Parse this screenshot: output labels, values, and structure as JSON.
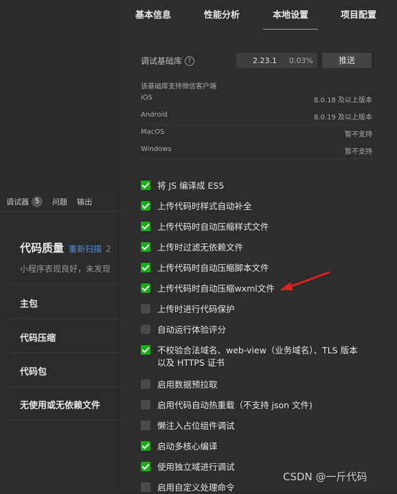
{
  "left": {
    "debug_tabs": {
      "debugger": "调试器",
      "debugger_count": "5",
      "problems": "问题",
      "output": "输出"
    },
    "quality_title": "代码质量",
    "rescan": "重新扫描",
    "quality_num": "2",
    "description": "小程序表现良好，未发现",
    "items": [
      "主包",
      "代码压缩",
      "代码包",
      "无使用或无依赖文件"
    ]
  },
  "tabs": [
    "基本信息",
    "性能分析",
    "本地设置",
    "项目配置"
  ],
  "active_tab": "本地设置",
  "lib": {
    "label": "调试基础库",
    "version": "2.23.1",
    "percent": "0.03%",
    "push": "推送"
  },
  "support_note": "该基础库支持微信客户端",
  "platforms": [
    {
      "name": "iOS",
      "req": "8.0.18 及以上版本"
    },
    {
      "name": "Android",
      "req": "8.0.19 及以上版本"
    },
    {
      "name": "MacOS",
      "req": "暂不支持"
    },
    {
      "name": "Windows",
      "req": "暂不支持"
    }
  ],
  "options": [
    {
      "label": "将 JS 编译成 ES5",
      "checked": true
    },
    {
      "label": "上传代码时样式自动补全",
      "checked": true
    },
    {
      "label": "上传代码时自动压缩样式文件",
      "checked": true
    },
    {
      "label": "上传时过滤无依赖文件",
      "checked": true
    },
    {
      "label": "上传代码时自动压缩脚本文件",
      "checked": true
    },
    {
      "label": "上传代码时自动压缩wxml文件",
      "checked": true
    },
    {
      "label": "上传时进行代码保护",
      "checked": false
    },
    {
      "label": "自动运行体验评分",
      "checked": false
    },
    {
      "label": "不校验合法域名、web-view（业务域名）、TLS 版本以及 HTTPS 证书",
      "checked": true
    },
    {
      "label": "启用数据预拉取",
      "checked": false
    },
    {
      "label": "启用代码自动热重载（不支持 json 文件)",
      "checked": false
    },
    {
      "label": "懒注入占位组件调试",
      "checked": false
    },
    {
      "label": "启动多核心编译",
      "checked": true
    },
    {
      "label": "使用独立域进行调试",
      "checked": true
    },
    {
      "label": "启用自定义处理命令",
      "checked": false
    }
  ],
  "watermark": "CSDN @一斤代码",
  "colors": {
    "check": "#1aad19",
    "arrow": "#e02020",
    "link": "#5a8bd6"
  }
}
